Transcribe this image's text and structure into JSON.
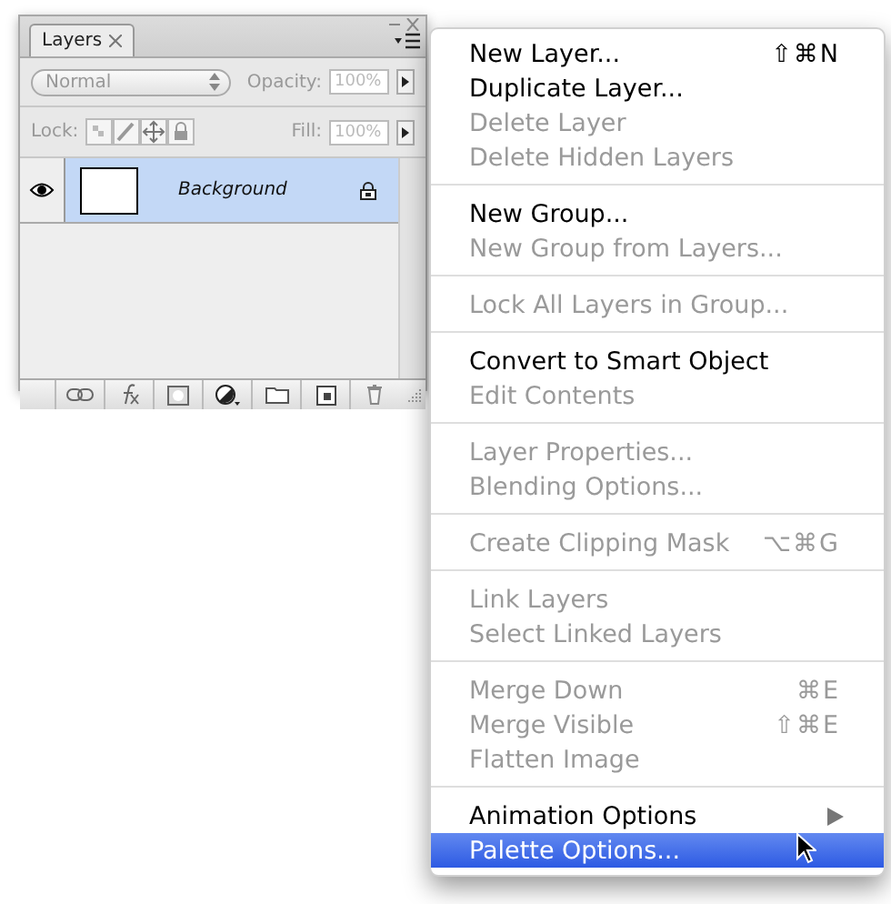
{
  "layers_panel": {
    "tab": {
      "label": "Layers",
      "selected": true
    },
    "blend_mode": "Normal",
    "opacity_label": "Opacity:",
    "opacity": "100%",
    "lock_label": "Lock:",
    "fill_label": "Fill:",
    "fill": "100%",
    "layers": [
      {
        "name": "Background",
        "visible": true,
        "locked": true,
        "selected": true
      }
    ]
  },
  "menu": {
    "groups": [
      [
        {
          "label": "New Layer...",
          "shortcut": "⇧⌘N",
          "disabled": false,
          "selected": false,
          "kind": "command"
        },
        {
          "label": "Duplicate Layer...",
          "disabled": false,
          "selected": false,
          "kind": "command"
        },
        {
          "label": "Delete Layer",
          "disabled": true,
          "selected": false,
          "kind": "command"
        },
        {
          "label": "Delete Hidden Layers",
          "disabled": true,
          "selected": false,
          "kind": "command"
        }
      ],
      [
        {
          "label": "New Group...",
          "disabled": false,
          "selected": false,
          "kind": "command"
        },
        {
          "label": "New Group from Layers...",
          "disabled": true,
          "selected": false,
          "kind": "command"
        }
      ],
      [
        {
          "label": "Lock All Layers in Group...",
          "disabled": true,
          "selected": false,
          "kind": "command"
        }
      ],
      [
        {
          "label": "Convert to Smart Object",
          "disabled": false,
          "selected": false,
          "kind": "command"
        },
        {
          "label": "Edit Contents",
          "disabled": true,
          "selected": false,
          "kind": "command"
        }
      ],
      [
        {
          "label": "Layer Properties...",
          "disabled": true,
          "selected": false,
          "kind": "command"
        },
        {
          "label": "Blending Options...",
          "disabled": true,
          "selected": false,
          "kind": "command"
        }
      ],
      [
        {
          "label": "Create Clipping Mask",
          "shortcut": "⌥⌘G",
          "disabled": true,
          "selected": false,
          "kind": "command"
        }
      ],
      [
        {
          "label": "Link Layers",
          "disabled": true,
          "selected": false,
          "kind": "command"
        },
        {
          "label": "Select Linked Layers",
          "disabled": true,
          "selected": false,
          "kind": "command"
        }
      ],
      [
        {
          "label": "Merge Down",
          "shortcut": "⌘E",
          "disabled": true,
          "selected": false,
          "kind": "command"
        },
        {
          "label": "Merge Visible",
          "shortcut": "⇧⌘E",
          "disabled": true,
          "selected": false,
          "kind": "command"
        },
        {
          "label": "Flatten Image",
          "disabled": true,
          "selected": false,
          "kind": "command"
        }
      ],
      [
        {
          "label": "Animation Options",
          "disabled": false,
          "selected": false,
          "kind": "submenu"
        },
        {
          "label": "Palette Options...",
          "disabled": false,
          "selected": true,
          "kind": "command"
        }
      ]
    ]
  }
}
